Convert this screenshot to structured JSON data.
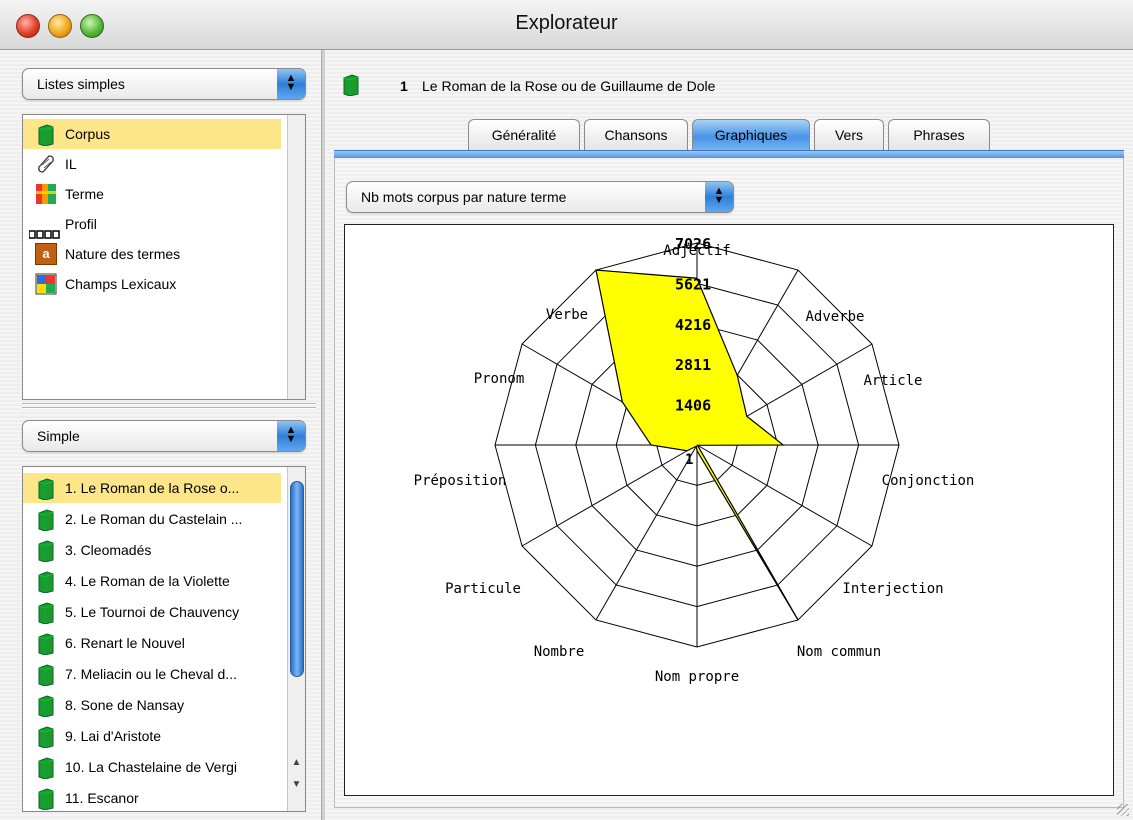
{
  "window": {
    "title": "Explorateur"
  },
  "left_top": {
    "popup_label": "Listes simples",
    "items": [
      {
        "label": "Corpus",
        "icon": "book-icon",
        "selected": true
      },
      {
        "label": "IL",
        "icon": "scroll-icon",
        "selected": false
      },
      {
        "label": "Terme",
        "icon": "color-bars-icon",
        "selected": false
      },
      {
        "label": "Profil",
        "icon": "dots-icon",
        "selected": false
      },
      {
        "label": "Nature des termes",
        "icon": "letter-a-icon",
        "selected": false
      },
      {
        "label": "Champs Lexicaux",
        "icon": "color-grid-icon",
        "selected": false
      }
    ]
  },
  "left_bottom": {
    "popup_label": "Simple",
    "items": [
      {
        "label": "1. Le Roman de la Rose o...",
        "selected": true
      },
      {
        "label": "2. Le Roman du Castelain ...",
        "selected": false
      },
      {
        "label": "3. Cleomadés",
        "selected": false
      },
      {
        "label": "4. Le Roman de la Violette",
        "selected": false
      },
      {
        "label": "5. Le Tournoi de Chauvency",
        "selected": false
      },
      {
        "label": "6. Renart le Nouvel",
        "selected": false
      },
      {
        "label": "7. Meliacin ou le Cheval d...",
        "selected": false
      },
      {
        "label": "8. Sone de Nansay",
        "selected": false
      },
      {
        "label": "9. Lai d'Aristote",
        "selected": false
      },
      {
        "label": "10. La Chastelaine de Vergi",
        "selected": false
      },
      {
        "label": "11. Escanor",
        "selected": false
      }
    ]
  },
  "document": {
    "number": "1",
    "title": "Le Roman de la Rose ou de Guillaume de Dole"
  },
  "tabs": [
    {
      "label": "Généralité",
      "active": false
    },
    {
      "label": "Chansons",
      "active": false
    },
    {
      "label": "Graphiques",
      "active": true
    },
    {
      "label": "Vers",
      "active": false
    },
    {
      "label": "Phrases",
      "active": false
    }
  ],
  "graph_selector": {
    "label": "Nb mots corpus par nature terme"
  },
  "colors": {
    "fill": "#ffff00",
    "selection": "#fde58a",
    "accent": "#4894e6"
  },
  "chart_data": {
    "type": "radar",
    "categories": [
      "Adjectif",
      "Adverbe",
      "Article",
      "Conjonction",
      "Interjection",
      "Nom commun",
      "Nom propre",
      "Nombre",
      "Particule",
      "Préposition",
      "Pronom",
      "Verbe"
    ],
    "values": [
      5800,
      2800,
      2000,
      3000,
      20,
      7026,
      200,
      50,
      400,
      1600,
      3000,
      7026
    ],
    "rings": [
      "1",
      "1406",
      "2811",
      "4216",
      "5621",
      "7026"
    ],
    "rmax": 7026
  }
}
